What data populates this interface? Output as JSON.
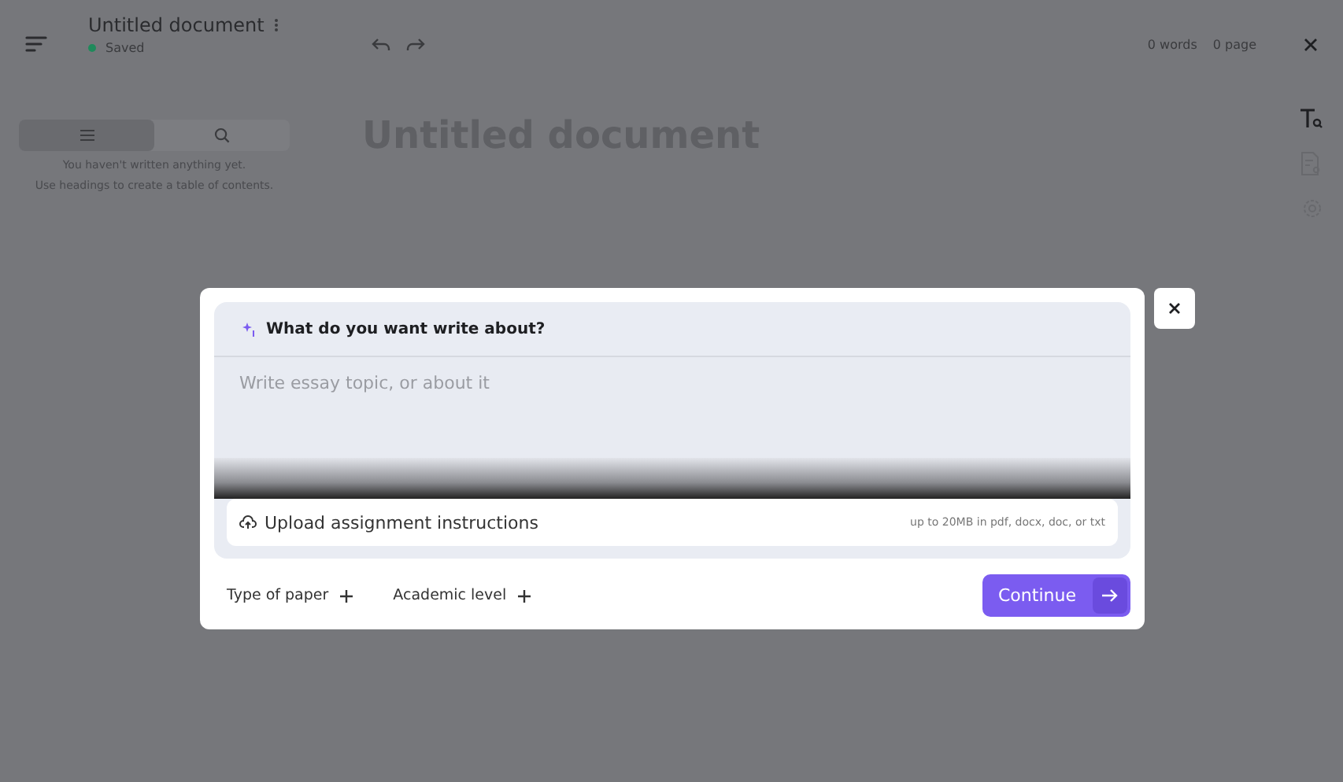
{
  "header": {
    "title": "Untitled document",
    "status": "Saved",
    "word_count": "0 words",
    "page_count": "0 page"
  },
  "sidebar": {
    "tabs": [
      {
        "kind": "outline",
        "selected": true
      },
      {
        "kind": "search",
        "selected": false
      }
    ],
    "empty_lines": [
      "You haven't written anything yet.",
      "Use headings to create a table of contents."
    ]
  },
  "document": {
    "title": "Untitled document"
  },
  "dialog": {
    "prompt_label": "What do you want write about?",
    "topic_field": {
      "placeholder": "Write essay topic, or about it"
    },
    "upload": {
      "label": "Upload assignment instructions",
      "hint": "up to 20MB in pdf, docx, doc, or txt"
    },
    "options": [
      "Type of paper",
      "Academic level"
    ],
    "continue_button": "Continue"
  }
}
